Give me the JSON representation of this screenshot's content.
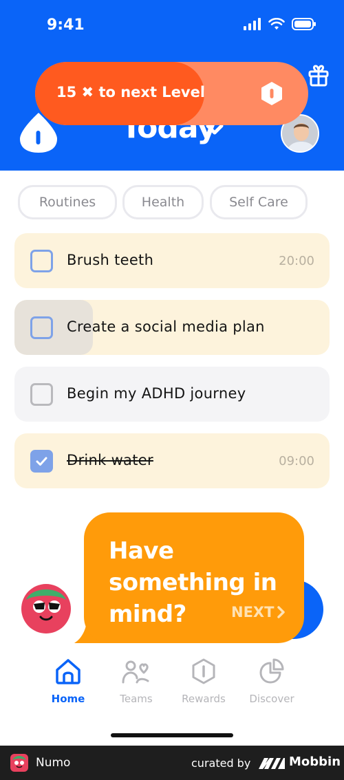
{
  "status_bar": {
    "time": "9:41",
    "icons": [
      "signal-icon",
      "wifi-icon",
      "battery-icon"
    ]
  },
  "header": {
    "level_progress_text": "15 ✖ to next Level",
    "level_progress_fraction": 0.62,
    "title": "Today",
    "accent_color": "#0a64f8",
    "progress_color": "#ff5a1f"
  },
  "filters": [
    {
      "label": "Routines"
    },
    {
      "label": "Health"
    },
    {
      "label": "Self Care"
    }
  ],
  "tasks": [
    {
      "label": "Brush teeth",
      "time": "20:00",
      "checked": false
    },
    {
      "label": "Create a social media plan",
      "time": "",
      "checked": false
    },
    {
      "label": "Begin my ADHD journey",
      "time": "",
      "checked": false
    },
    {
      "label": "Drink water",
      "time": "09:00",
      "checked": true
    }
  ],
  "tooltip": {
    "message": "Have something in mind?",
    "next_label": "NEXT"
  },
  "bottom_nav": [
    {
      "label": "Home",
      "icon": "home-icon",
      "active": true
    },
    {
      "label": "Teams",
      "icon": "teams-icon",
      "active": false
    },
    {
      "label": "Rewards",
      "icon": "rewards-icon",
      "active": false
    },
    {
      "label": "Discover",
      "icon": "discover-icon",
      "active": false
    }
  ],
  "footer": {
    "app_name": "Numo",
    "curated_by": "curated by",
    "brand": "Mobbin"
  }
}
